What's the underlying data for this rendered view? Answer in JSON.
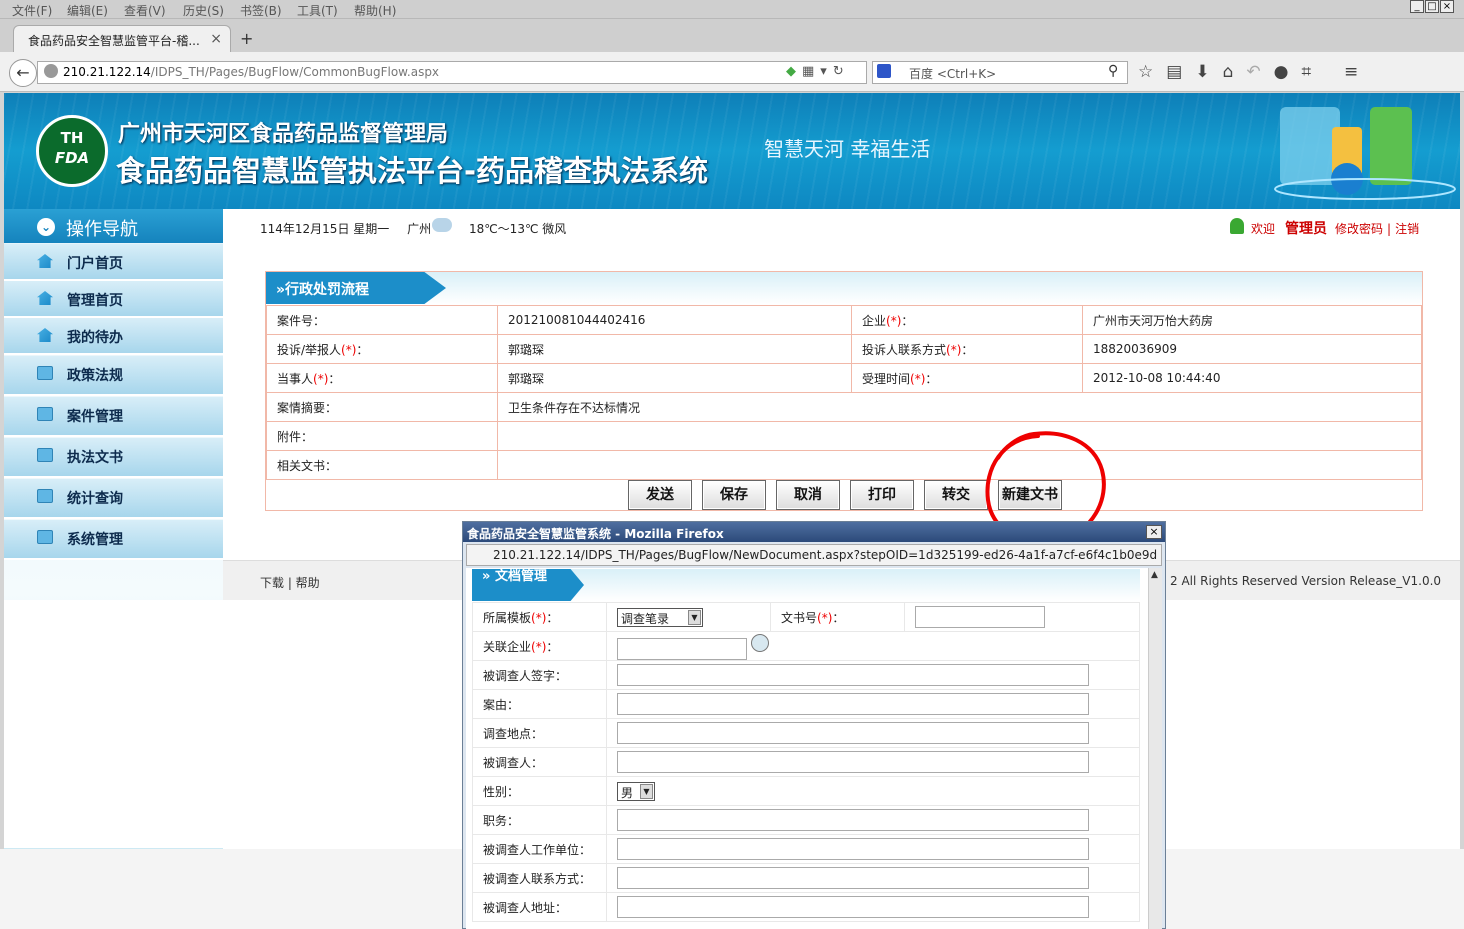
{
  "browser": {
    "menu": [
      "文件(F)",
      "编辑(E)",
      "查看(V)",
      "历史(S)",
      "书签(B)",
      "工具(T)",
      "帮助(H)"
    ],
    "tab_title": "食品药品安全智慧监管平台-稽...",
    "url_host": "210.21.122.14",
    "url_path": "/IDPS_TH/Pages/BugFlow/CommonBugFlow.aspx",
    "search_placeholder": "百度 <Ctrl+K>"
  },
  "header": {
    "logo_line1": "TH",
    "logo_line2": "FDA",
    "org": "广州市天河区食品药品监督管理局",
    "system": "食品药品智慧监管执法平台-药品稽查执法系统",
    "slogan": "智慧天河 幸福生活"
  },
  "sidebar": {
    "title": "操作导航",
    "items": [
      {
        "label": "门户首页",
        "icon": "home-icon"
      },
      {
        "label": "管理首页",
        "icon": "home-icon"
      },
      {
        "label": "我的待办",
        "icon": "home-icon"
      },
      {
        "label": "政策法规",
        "icon": "folder-icon"
      },
      {
        "label": "案件管理",
        "icon": "folder-icon"
      },
      {
        "label": "执法文书",
        "icon": "folder-icon"
      },
      {
        "label": "统计查询",
        "icon": "folder-icon"
      },
      {
        "label": "系统管理",
        "icon": "folder-icon"
      }
    ]
  },
  "infobar": {
    "date": "114年12月15日 星期一",
    "city": "广州",
    "weather": "18℃～13℃  微风",
    "welcome": "欢迎",
    "user": "管理员",
    "change_password": "修改密码",
    "logout": "注销"
  },
  "flow": {
    "title": "行政处罚流程",
    "case_no_label": "案件号：",
    "case_no": "201210081044402416",
    "company_label": "企业",
    "company": "广州市天河万怡大药房",
    "reporter_label": "投诉/举报人",
    "reporter": "郭璐琛",
    "contact_label": "投诉人联系方式",
    "contact": "18820036909",
    "party_label": "当事人",
    "party": "郭璐琛",
    "accept_time_label": "受理时间",
    "accept_time": "2012-10-08 10:44:40",
    "summary_label": "案情摘要：",
    "summary": "卫生条件存在不达标情况",
    "attach_label": "附件：",
    "docs_label": "相关文书：",
    "req_mark": "(*)",
    "colon": "：",
    "buttons": [
      "发送",
      "保存",
      "取消",
      "打印",
      "转交",
      "新建文书"
    ]
  },
  "footer": {
    "left": "下载 | 帮助",
    "right": "2 All Rights Reserved Version Release_V1.0.0"
  },
  "popup": {
    "title": "食品药品安全智慧监管系统 - Mozilla Firefox",
    "url": "210.21.122.14/IDPS_TH/Pages/BugFlow/NewDocument.aspx?stepOID=1d325199-ed26-4a1f-a7cf-e6f4c1b0e9d",
    "section_title": "文档管理",
    "template_label": "所属模板",
    "template_value": "调查笔录",
    "docno_label": "文书号",
    "company_label": "关联企业",
    "req_mark": "(*)",
    "colon": "：",
    "fields": [
      "被调查人签字：",
      "案由：",
      "调查地点：",
      "被调查人：",
      "性别：",
      "职务：",
      "被调查人工作单位：",
      "被调查人联系方式：",
      "被调查人地址："
    ],
    "gender_value": "男"
  }
}
